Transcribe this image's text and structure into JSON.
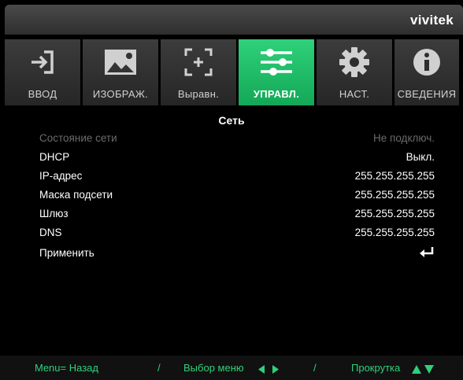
{
  "brand": "vivitek",
  "tabs": [
    {
      "label": "ВВОД",
      "icon": "input-icon"
    },
    {
      "label": "ИЗОБРАЖ.",
      "icon": "image-icon"
    },
    {
      "label": "Выравн.",
      "icon": "alignment-icon"
    },
    {
      "label": "УПРАВЛ.",
      "icon": "sliders-icon"
    },
    {
      "label": "НАСТ.",
      "icon": "gear-icon"
    },
    {
      "label": "СВЕДЕНИЯ",
      "icon": "info-icon"
    }
  ],
  "active_tab": "УПРАВЛ.",
  "panel": {
    "title": "Сеть",
    "rows": [
      {
        "label": "Состояние сети",
        "value": "Не подключ.",
        "dimmed": true
      },
      {
        "label": "DHCP",
        "value": "Выкл.",
        "dimmed": false
      },
      {
        "label": "IP-адрес",
        "value": "255.255.255.255",
        "dimmed": false
      },
      {
        "label": "Маска подсети",
        "value": "255.255.255.255",
        "dimmed": false
      },
      {
        "label": "Шлюз",
        "value": "255.255.255.255",
        "dimmed": false
      },
      {
        "label": "DNS",
        "value": "255.255.255.255",
        "dimmed": false
      },
      {
        "label": "Применить",
        "value": "",
        "icon": "enter-icon",
        "dimmed": false
      }
    ]
  },
  "footer": {
    "back": "Menu= Назад",
    "separator": "/",
    "select": "Выбор меню",
    "scroll": "Прокрутка"
  },
  "colors": {
    "accent": "#1fbf6a",
    "dimmed_text": "#6b6b6b",
    "text": "#ffffff"
  }
}
